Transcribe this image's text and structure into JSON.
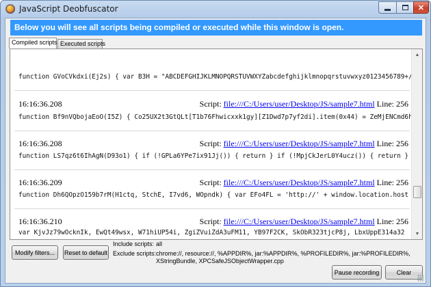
{
  "window": {
    "title": "JavaScript Deobfuscator"
  },
  "banner": {
    "text": "Below you will see all scripts being compiled or executed while this window is open."
  },
  "tabs": [
    {
      "label": "Compiled scripts",
      "active": true
    },
    {
      "label": "Executed scripts",
      "active": false
    }
  ],
  "log": {
    "first_code": "function GVoCVkdxi(Ej2s) { var B3H = \"ABCDEFGHIJKLMNOPQRSTUVWXYZabcdefghijklmnopqrstuvwxyz0123456789+/",
    "script_prefix": "Script:",
    "line_prefix": "Line:",
    "entries": [
      {
        "time": "16:16:36.208",
        "file": "file:///C:/Users/user/Desktop/JS/sample7.html",
        "line": "256",
        "code": "function Bf9nVQbojaEoO(I5Z) { Co25UX2t3GtQLt[T1b76Fhwicxxk1gy][Z1Dwd7p7yf2di].item(0x44) = ZeMjENCmd6h"
      },
      {
        "time": "16:16:36.208",
        "file": "file:///C:/Users/user/Desktop/JS/sample7.html",
        "line": "256",
        "code": "function LS7qz6t6IhAgN(D93o1) { if (!GPLa6YPe7ix91Jj()) { return }  if (!MpjCkJerL0Y4ucz()) { return }"
      },
      {
        "time": "16:16:36.209",
        "file": "file:///C:/Users/user/Desktop/JS/sample7.html",
        "line": "256",
        "code": "function Dh6QOpzO159b7rM(H1ctq, StchE, I7vd6, WOpndk) { var EFo4FL = 'http://' + window.location.host"
      },
      {
        "time": "16:16:36.210",
        "file": "file:///C:/Users/user/Desktop/JS/sample7.html",
        "line": "256",
        "code": "  var KjvJz79wOcknIk, EwQt49wsx, W71hiUP54i, ZgiZVuiZdA3uFM11, YB97F2CK, SkObR323tjcP8j, LbxUppE314a32"
      }
    ]
  },
  "filters": {
    "modify_label": "Modify filters...",
    "reset_label": "Reset to default",
    "include_label": "Include scripts:",
    "include_value": "all",
    "exclude_label": "Exclude scripts:",
    "exclude_value": "chrome://, resource://, %APPDIR%, jar:%APPDIR%, %PROFILEDIR%, jar:%PROFILEDIR%, XStringBundle, XPCSafeJSObjectWrapper.cpp"
  },
  "actions": {
    "pause_label": "Pause recording",
    "clear_label": "Clear"
  },
  "icons": {
    "app": "firefox-icon",
    "minimize": "minimize-icon",
    "maximize": "maximize-icon",
    "close": "close-icon"
  },
  "colors": {
    "banner": "#3399ff",
    "link": "#0000ee",
    "close_button": "#c7412a"
  }
}
